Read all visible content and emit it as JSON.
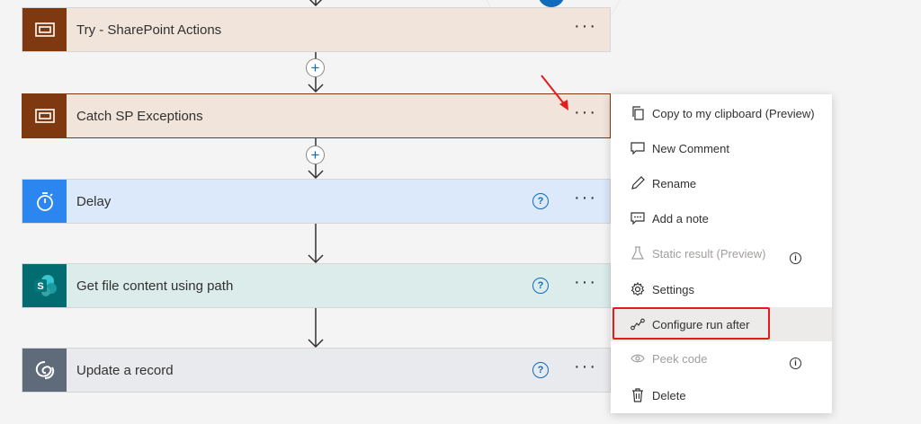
{
  "flow": {
    "steps": [
      {
        "title": "Try - SharePoint Actions",
        "icon": "scope-icon"
      },
      {
        "title": "Catch SP Exceptions",
        "icon": "scope-icon"
      },
      {
        "title": "Delay",
        "icon": "timer-icon",
        "help": "?"
      },
      {
        "title": "Get file content using path",
        "icon": "sharepoint-icon",
        "help": "?"
      },
      {
        "title": "Update a record",
        "icon": "dataverse-icon",
        "help": "?"
      }
    ],
    "more_label": "···",
    "add_label": "+"
  },
  "menu": {
    "items": [
      {
        "label": "Copy to my clipboard (Preview)",
        "icon": "copy-icon"
      },
      {
        "label": "New Comment",
        "icon": "comment-icon"
      },
      {
        "label": "Rename",
        "icon": "pencil-icon"
      },
      {
        "label": "Add a note",
        "icon": "note-icon"
      },
      {
        "label": "Static result (Preview)",
        "icon": "flask-icon",
        "disabled": true,
        "info": "i"
      },
      {
        "label": "Settings",
        "icon": "gear-icon"
      },
      {
        "label": "Configure run after",
        "icon": "run-after-icon",
        "highlighted": true
      },
      {
        "label": "Peek code",
        "icon": "eye-icon",
        "disabled": true,
        "info": "i"
      },
      {
        "label": "Delete",
        "icon": "trash-icon"
      }
    ]
  },
  "colors": {
    "scope": "#7f3911",
    "delay": "#2b86f0",
    "sharepoint": "#036c70",
    "dataverse": "#5f6b7a",
    "annotation": "#e31b1b",
    "accent": "#0f6cbd"
  }
}
